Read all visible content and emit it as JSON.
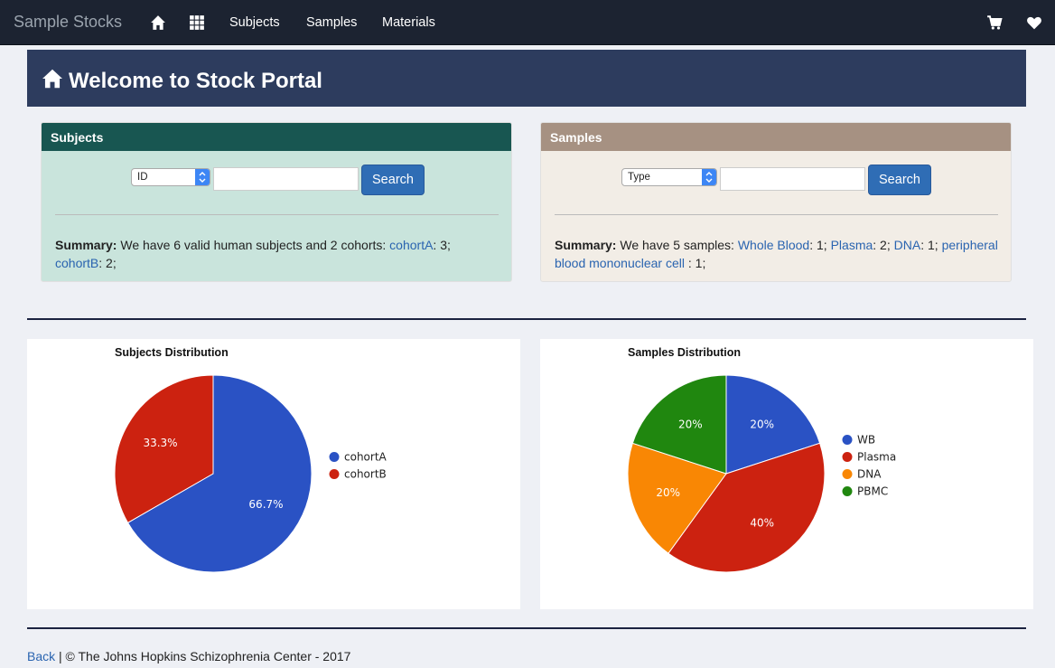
{
  "navbar": {
    "brand": "Sample Stocks",
    "links": [
      "Subjects",
      "Samples",
      "Materials"
    ],
    "icons": [
      "home-icon",
      "grid-icon",
      "cart-icon",
      "heart-icon"
    ]
  },
  "header": {
    "title": "Welcome to Stock Portal"
  },
  "subjects_panel": {
    "title": "Subjects",
    "select_value": "ID",
    "search_label": "Search",
    "summary_label": "Summary:",
    "summary_text": " We have 6 valid human subjects and 2 cohorts: ",
    "cohortA_link": "cohortA",
    "cohortA_count": ": 3;",
    "cohortB_link": "cohortB",
    "cohortB_count": ": 2;"
  },
  "samples_panel": {
    "title": "Samples",
    "select_value": "Type",
    "search_label": "Search",
    "summary_label": "Summary:",
    "summary_text": " We have 5 samples: ",
    "wb_link": "Whole Blood",
    "wb_count": ": 1; ",
    "plasma_link": "Plasma",
    "plasma_count": ": 2; ",
    "dna_link": "DNA",
    "dna_count": ": 1; ",
    "pbmc_link": "peripheral blood mononuclear cell",
    "pbmc_count": " : 1;"
  },
  "colors": {
    "subjects_header": "#185651",
    "subjects_body": "#c9e4dc",
    "samples_header": "#a69182",
    "samples_body": "#f2ede6",
    "blue": "#2a52c4",
    "red": "#cc2210",
    "orange": "#f98704",
    "green": "#20870f"
  },
  "chart_data": [
    {
      "type": "pie",
      "title": "Subjects Distribution",
      "categories": [
        "cohortA",
        "cohortB"
      ],
      "values": [
        66.7,
        33.3
      ],
      "labels": [
        "66.7%",
        "33.3%"
      ],
      "colors": [
        "#2a52c4",
        "#cc2210"
      ],
      "legend": "right"
    },
    {
      "type": "pie",
      "title": "Samples Distribution",
      "categories": [
        "WB",
        "Plasma",
        "DNA",
        "PBMC"
      ],
      "values": [
        20,
        40,
        20,
        20
      ],
      "labels": [
        "20%",
        "40%",
        "20%",
        "20%"
      ],
      "colors": [
        "#2a52c4",
        "#cc2210",
        "#f98704",
        "#20870f"
      ],
      "legend": "right"
    }
  ],
  "footer": {
    "back_link": "Back",
    "text": " | © The Johns Hopkins Schizophrenia Center - 2017"
  }
}
